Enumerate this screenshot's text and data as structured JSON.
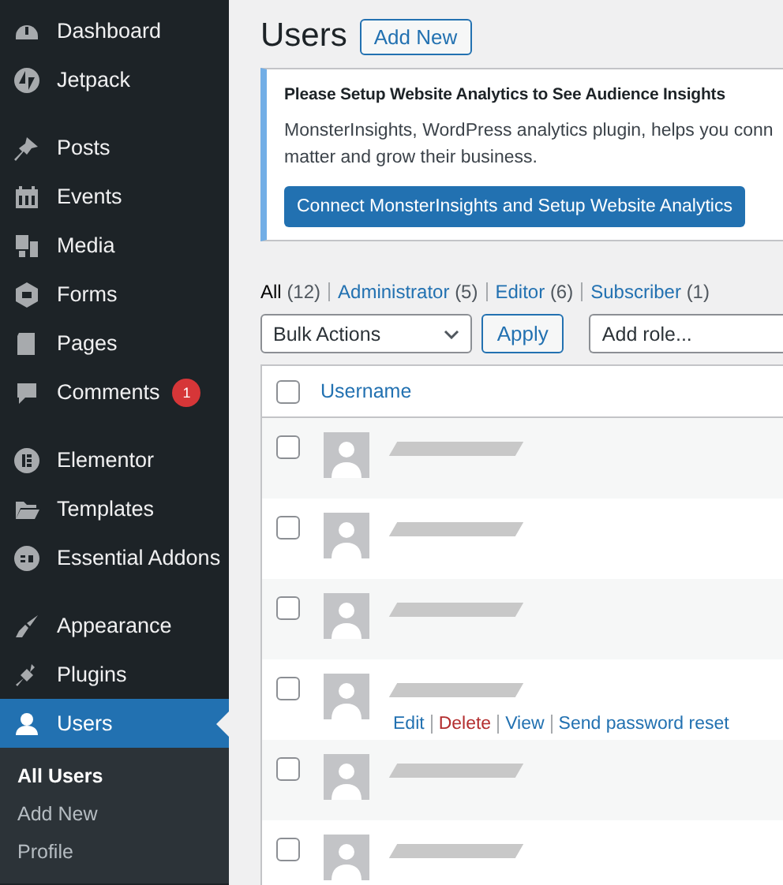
{
  "sidebar": {
    "groups": [
      {
        "items": [
          {
            "label": "Dashboard",
            "kind": "dashboard",
            "selected": false
          },
          {
            "label": "Jetpack",
            "kind": "jetpack",
            "selected": false
          }
        ]
      },
      {
        "items": [
          {
            "label": "Posts",
            "kind": "pin",
            "selected": false
          },
          {
            "label": "Events",
            "kind": "calendar",
            "selected": false
          },
          {
            "label": "Media",
            "kind": "media",
            "selected": false
          },
          {
            "label": "Forms",
            "kind": "forms",
            "selected": false
          },
          {
            "label": "Pages",
            "kind": "pages",
            "selected": false
          },
          {
            "label": "Comments",
            "kind": "comment",
            "selected": false,
            "badge": "1"
          }
        ]
      },
      {
        "items": [
          {
            "label": "Elementor",
            "kind": "elementor",
            "selected": false
          },
          {
            "label": "Templates",
            "kind": "folder",
            "selected": false
          },
          {
            "label": "Essential Addons",
            "kind": "ea",
            "selected": false
          }
        ]
      },
      {
        "items": [
          {
            "label": "Appearance",
            "kind": "brush",
            "selected": false
          },
          {
            "label": "Plugins",
            "kind": "plug",
            "selected": false
          },
          {
            "label": "Users",
            "kind": "user",
            "selected": true,
            "submenu": [
              {
                "label": "All Users",
                "selected": true
              },
              {
                "label": "Add New",
                "selected": false
              },
              {
                "label": "Profile",
                "selected": false
              }
            ]
          }
        ]
      }
    ]
  },
  "page": {
    "title": "Users",
    "add_new": "Add New"
  },
  "notice": {
    "heading": "Please Setup Website Analytics to See Audience Insights",
    "text": "MonsterInsights, WordPress analytics plugin, helps you conn",
    "text_line_2": "matter and grow their business.",
    "button": "Connect MonsterInsights and Setup Website Analytics"
  },
  "filters": [
    {
      "label": "All",
      "count": "(12)",
      "selected": true
    },
    {
      "label": "Administrator",
      "count": "(5)",
      "selected": false
    },
    {
      "label": "Editor",
      "count": "(6)",
      "selected": false
    },
    {
      "label": "Subscriber",
      "count": "(1)",
      "selected": false
    }
  ],
  "bulk_actions": {
    "value": "Bulk Actions",
    "apply": "Apply",
    "role_value": "Add role..."
  },
  "table": {
    "columns": [
      "Username"
    ],
    "header_checked": false,
    "rows": [
      {
        "checked": false
      },
      {
        "checked": false
      },
      {
        "checked": false
      },
      {
        "checked": false,
        "actions": [
          {
            "label": "Edit",
            "kind": "link"
          },
          {
            "label": "Delete",
            "kind": "delete"
          },
          {
            "label": "View",
            "kind": "link"
          },
          {
            "label": "Send password reset",
            "kind": "link"
          }
        ]
      },
      {
        "checked": false
      },
      {
        "checked": false
      }
    ]
  }
}
